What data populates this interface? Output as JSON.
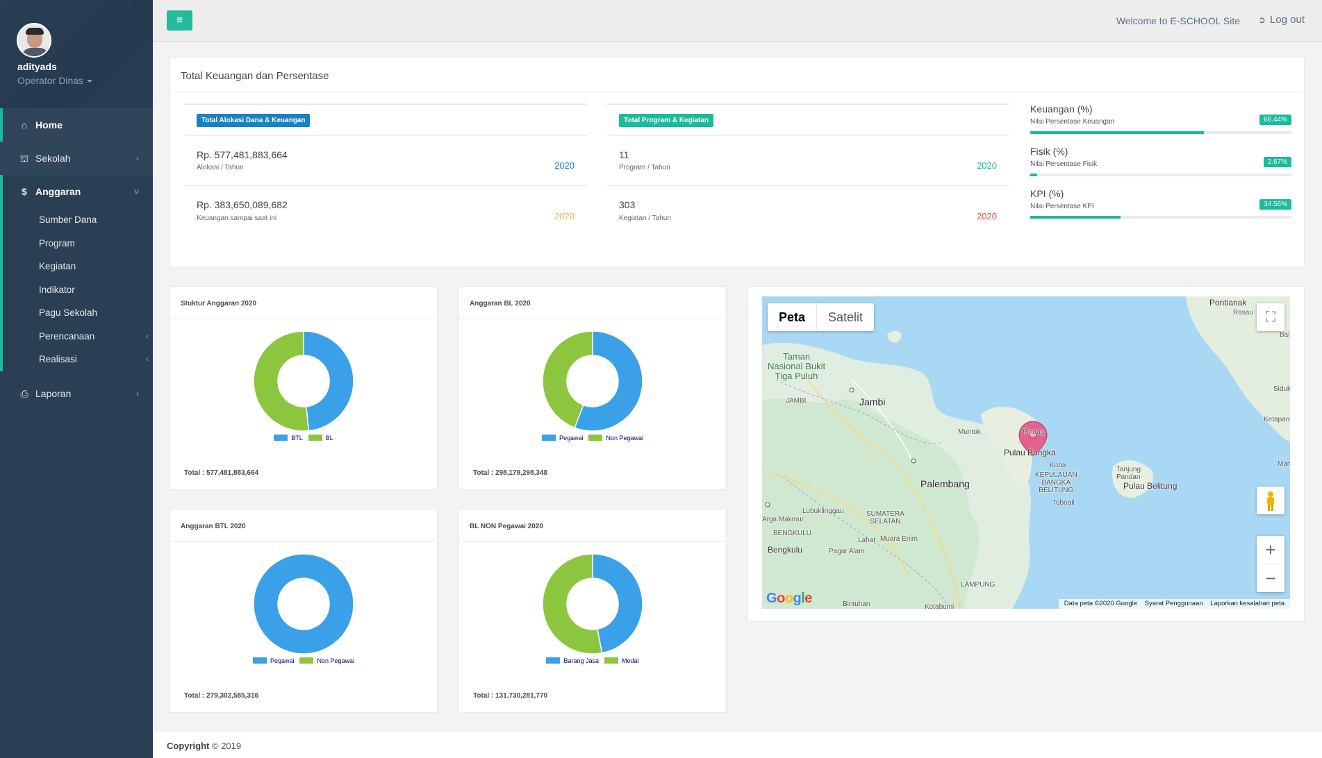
{
  "user": {
    "name": "adityads",
    "role": "Operator Dinas"
  },
  "sidebar": {
    "home": "Home",
    "sekolah": "Sekolah",
    "anggaran": "Anggaran",
    "anggaran_items": [
      "Sumber Dana",
      "Program",
      "Kegiatan",
      "Indikator",
      "Pagu Sekolah",
      "Perencanaan",
      "Realisasi"
    ],
    "laporan": "Laporan"
  },
  "topbar": {
    "welcome": "Welcome to E-SCHOOL Site",
    "logout": "Log out"
  },
  "summary": {
    "title": "Total Keuangan dan Persentase",
    "alokasi": {
      "badge": "Total Alokasi Dana & Keuangan",
      "row1_value": "Rp. 577,481,883,664",
      "row1_label": "Alokasi / Tahun",
      "row1_year": "2020",
      "row2_value": "Rp. 383,650,089,682",
      "row2_label": "Keuangan sampai saat ini",
      "row2_year": "2020"
    },
    "program": {
      "badge": "Total Program & Kegiatan",
      "row1_value": "11",
      "row1_label": "Program / Tahun",
      "row1_year": "2020",
      "row2_value": "303",
      "row2_label": "Kegiatan / Tahun",
      "row2_year": "2020"
    },
    "progress": [
      {
        "title": "Keuangan (%)",
        "subtitle": "Nilai Persentase Keuangan",
        "badge": "66.44%",
        "value": 66.44
      },
      {
        "title": "Fisik (%)",
        "subtitle": "Nilai Persentase Fisik",
        "badge": "2.67%",
        "value": 2.67
      },
      {
        "title": "KPI (%)",
        "subtitle": "Nilai Persentase KPI",
        "badge": "34.56%",
        "value": 34.56
      }
    ]
  },
  "colors": {
    "blue": "#3aa0e8",
    "green": "#8cc63f",
    "accent": "#1abb9c",
    "sidebar": "#2a3f54"
  },
  "chart_data": [
    {
      "type": "pie",
      "title": "Stuktur Anggaran 2020",
      "categories": [
        "BTL",
        "BL"
      ],
      "values": [
        279302585316,
        298179298348
      ],
      "total_label": "Total : 577,481,883,664"
    },
    {
      "type": "pie",
      "title": "Anggaran BL 2020",
      "categories": [
        "Pegawai",
        "Non Pegawai"
      ],
      "values": [
        166449016578,
        131730281770
      ],
      "total_label": "Total : 298,179,298,348"
    },
    {
      "type": "pie",
      "title": "Anggaran BTL 2020",
      "categories": [
        "Pegawai",
        "Non Pegawai"
      ],
      "values": [
        279302585316,
        0
      ],
      "total_label": "Total : 279,302,585,316"
    },
    {
      "type": "pie",
      "title": "BL NON Pegawai 2020",
      "categories": [
        "Barang Jasa",
        "Modal"
      ],
      "values": [
        61900000000,
        69830281770
      ],
      "total_label": "Total : 131,730,281,770"
    }
  ],
  "map": {
    "tabs": [
      "Peta",
      "Satelit"
    ],
    "labels": {
      "pontianak": "Pontianak",
      "rasau": "Rasau",
      "bal": "Bal",
      "taman": "Taman\nNasional Bukit\nTiga Puluh",
      "jambi_prov": "JAMBI",
      "jambi": "Jambi",
      "muntok": "Muntok",
      "pulau_bangka": "Pulau Bangka",
      "pinang": "Pinang",
      "koba": "Koba",
      "kep": "KEPULAUAN\nBANGKA\nBELITUNG",
      "toboali": "Toboali",
      "tanjung": "Tanjung\nPandan",
      "belitung": "Pulau Belitung",
      "sidak": "Siduk",
      "ketapang": "Ketapang",
      "man": "Man",
      "palembang": "Palembang",
      "lubuk": "Lubuklinggau",
      "sumsel": "SUMATERA\nSELATAN",
      "argamakmur": "Arga Makmur",
      "bengkulu_prov": "BENGKULU",
      "bengkulu": "Bengkulu",
      "lahat": "Lahat",
      "muaraenim": "Muara Enim",
      "pagaralam": "Pagar Alam",
      "lampung": "LAMPUNG",
      "bintuhan": "Bintuhan",
      "kotabumi": "Kotabumi"
    },
    "google": "Google",
    "attribution": [
      "Data peta ©2020 Google",
      "Syarat Penggunaan",
      "Laporkan kesalahan peta"
    ]
  },
  "footer": {
    "copyright_bold": "Copyright",
    "copyright_rest": "© 2019"
  }
}
